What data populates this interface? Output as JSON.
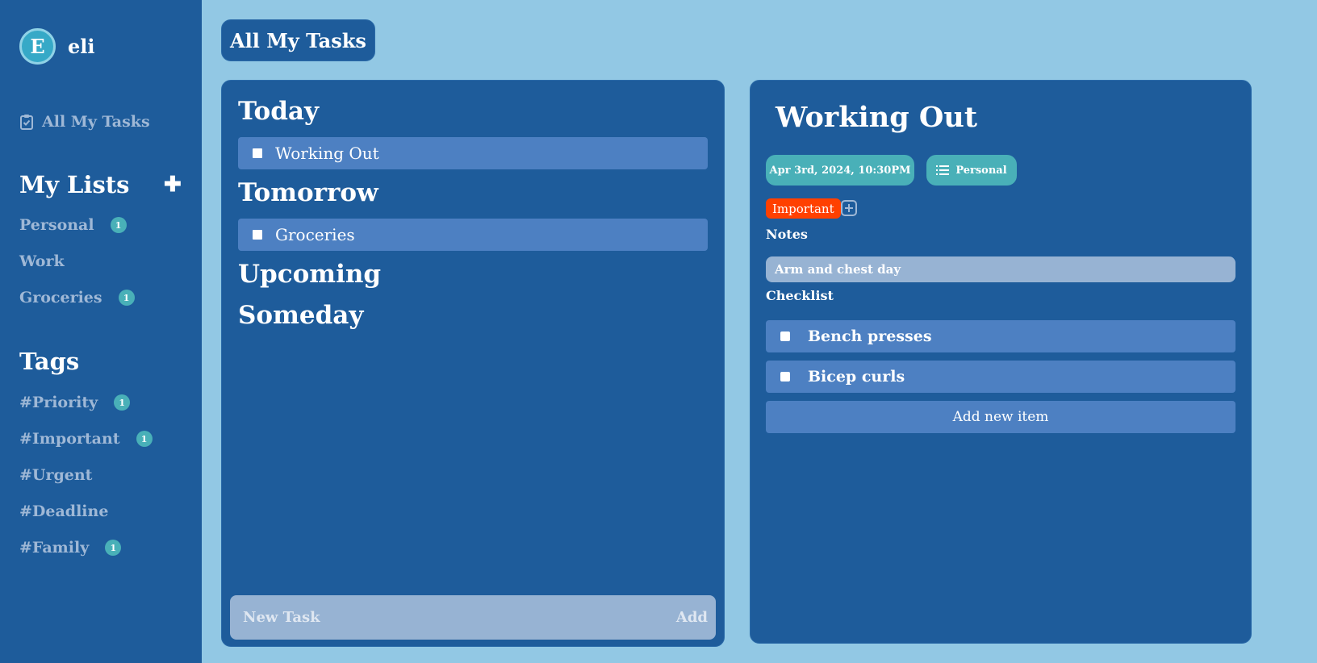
{
  "user": {
    "initial": "E",
    "name": "eli"
  },
  "sidebar": {
    "all_tasks_label": "All My Tasks",
    "lists_title": "My Lists",
    "add_list_symbol": "✚",
    "lists": [
      {
        "label": "Personal",
        "count": "1"
      },
      {
        "label": "Work",
        "count": ""
      },
      {
        "label": "Groceries",
        "count": "1"
      }
    ],
    "tags_title": "Tags",
    "tags": [
      {
        "label": "#Priority",
        "count": "1"
      },
      {
        "label": "#Important",
        "count": "1"
      },
      {
        "label": "#Urgent",
        "count": ""
      },
      {
        "label": "#Deadline",
        "count": ""
      },
      {
        "label": "#Family",
        "count": "1"
      }
    ]
  },
  "header": {
    "title": "All My Tasks"
  },
  "tasks": {
    "groups": [
      {
        "title": "Today",
        "items": [
          "Working Out"
        ]
      },
      {
        "title": "Tomorrow",
        "items": [
          "Groceries"
        ]
      },
      {
        "title": "Upcoming",
        "items": []
      },
      {
        "title": "Someday",
        "items": []
      }
    ],
    "new_task_placeholder": "New Task",
    "add_label": "Add"
  },
  "detail": {
    "title": "Working Out",
    "date": "Apr 3rd, 2024, 10:30PM",
    "list": "Personal",
    "tag": "Important",
    "notes_label": "Notes",
    "notes": "Arm and chest day",
    "checklist_label": "Checklist",
    "checklist": [
      "Bench presses",
      "Bicep curls"
    ],
    "add_item_label": "Add new item"
  },
  "colors": {
    "background": "#92c8e4",
    "panel": "#1e5c9b",
    "row": "#4d80c2",
    "badge": "#49b0b8",
    "important": "#ff4000"
  },
  "icons": {
    "all_tasks": "clipboard-check-icon",
    "list": "list-icon",
    "add_tag": "plus-square-icon",
    "add_list": "plus-icon"
  }
}
